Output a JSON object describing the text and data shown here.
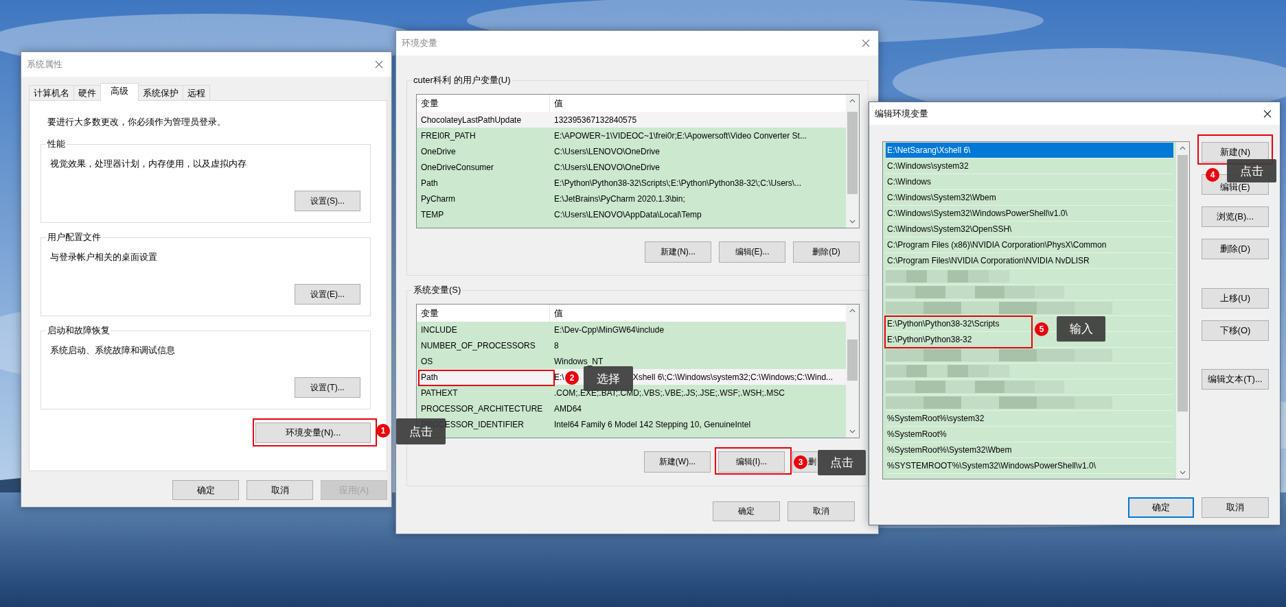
{
  "system_properties": {
    "title": "系统属性",
    "tabs": [
      {
        "label": "计算机名",
        "selected": false
      },
      {
        "label": "硬件",
        "selected": false
      },
      {
        "label": "高级",
        "selected": true
      },
      {
        "label": "系统保护",
        "selected": false
      },
      {
        "label": "远程",
        "selected": false
      }
    ],
    "notice": "要进行大多数更改，你必须作为管理员登录。",
    "groups": [
      {
        "title": "性能",
        "description": "视觉效果，处理器计划，内存使用，以及虚拟内存",
        "button": "设置(S)..."
      },
      {
        "title": "用户配置文件",
        "description": "与登录帐户相关的桌面设置",
        "button": "设置(E)..."
      },
      {
        "title": "启动和故障恢复",
        "description": "系统启动、系统故障和调试信息",
        "button": "设置(T)..."
      }
    ],
    "env_button": "环境变量(N)...",
    "buttons": [
      {
        "label": "确定",
        "disabled": false
      },
      {
        "label": "取消",
        "disabled": false
      },
      {
        "label": "应用(A)",
        "disabled": true
      }
    ]
  },
  "environment_variables": {
    "title": "环境变量",
    "sections": [
      {
        "title": "cuter科利 的用户变量(U)",
        "columns": [
          "变量",
          "值"
        ],
        "rows": [
          {
            "name": "ChocolateyLastPathUpdate",
            "value": "132395367132840575",
            "selected": true
          },
          {
            "name": "FREI0R_PATH",
            "value": "E:\\APOWER~1\\VIDEOC~1\\frei0r;E:\\Apowersoft\\Video Converter St...",
            "selected": false
          },
          {
            "name": "OneDrive",
            "value": "C:\\Users\\LENOVO\\OneDrive",
            "selected": false
          },
          {
            "name": "OneDriveConsumer",
            "value": "C:\\Users\\LENOVO\\OneDrive",
            "selected": false
          },
          {
            "name": "Path",
            "value": "E:\\Python\\Python38-32\\Scripts\\;E:\\Python\\Python38-32\\;C:\\Users\\...",
            "selected": false
          },
          {
            "name": "PyCharm",
            "value": "E:\\JetBrains\\PyCharm 2020.1.3\\bin;",
            "selected": false
          },
          {
            "name": "TEMP",
            "value": "C:\\Users\\LENOVO\\AppData\\Local\\Temp",
            "selected": false
          }
        ],
        "buttons": [
          "新建(N)...",
          "编辑(E)...",
          "删除(D)"
        ]
      },
      {
        "title": "系统变量(S)",
        "columns": [
          "变量",
          "值"
        ],
        "rows": [
          {
            "name": "INCLUDE",
            "value": "E:\\Dev-Cpp\\MinGW64\\include",
            "selected": false
          },
          {
            "name": "NUMBER_OF_PROCESSORS",
            "value": "8",
            "selected": false
          },
          {
            "name": "OS",
            "value": "Windows_NT",
            "selected": false
          },
          {
            "name": "Path",
            "value": [
              "E:\\",
              "Xshell 6\\;C:\\Windows\\system32;C:\\Windows;C:\\Wind..."
            ],
            "selected": true
          },
          {
            "name": "PATHEXT",
            "value": ".COM;.EXE;.BAT;.CMD;.VBS;.VBE;.JS;.JSE;.WSF;.WSH;.MSC",
            "selected": false
          },
          {
            "name": "PROCESSOR_ARCHITECTURE",
            "value": "AMD64",
            "selected": false
          },
          {
            "name": "PROCESSOR_IDENTIFIER",
            "value": "Intel64 Family 6 Model 142 Stepping 10, GenuineIntel",
            "selected": false
          }
        ],
        "buttons": [
          "新建(W)...",
          "编辑(I)...",
          "删"
        ]
      }
    ],
    "buttons": [
      "确定",
      "取消"
    ]
  },
  "edit_variable": {
    "title": "编辑环境变量",
    "entries": [
      {
        "kind": "path",
        "text": "E:\\NetSarang\\Xshell 6\\",
        "selected": true
      },
      {
        "kind": "path",
        "text": "C:\\Windows\\system32",
        "selected": false
      },
      {
        "kind": "path",
        "text": "C:\\Windows",
        "selected": false
      },
      {
        "kind": "path",
        "text": "C:\\Windows\\System32\\Wbem",
        "selected": false
      },
      {
        "kind": "path",
        "text": "C:\\Windows\\System32\\WindowsPowerShell\\v1.0\\",
        "selected": false
      },
      {
        "kind": "path",
        "text": "C:\\Windows\\System32\\OpenSSH\\",
        "selected": false
      },
      {
        "kind": "path",
        "text": "C:\\Program Files (x86)\\NVIDIA Corporation\\PhysX\\Common",
        "selected": false
      },
      {
        "kind": "path",
        "text": "C:\\Program Files\\NVIDIA Corporation\\NVIDIA NvDLISR",
        "selected": false
      },
      {
        "kind": "blurred"
      },
      {
        "kind": "blurred"
      },
      {
        "kind": "blurred"
      },
      {
        "kind": "path",
        "text": "E:\\Python\\Python38-32\\Scripts",
        "selected": false
      },
      {
        "kind": "path",
        "text": "E:\\Python\\Python38-32",
        "selected": false
      },
      {
        "kind": "blurred"
      },
      {
        "kind": "blurred"
      },
      {
        "kind": "blurred"
      },
      {
        "kind": "blurred"
      },
      {
        "kind": "path",
        "text": "%SystemRoot%\\system32",
        "selected": false
      },
      {
        "kind": "path",
        "text": "%SystemRoot%",
        "selected": false
      },
      {
        "kind": "path",
        "text": "%SystemRoot%\\System32\\Wbem",
        "selected": false
      },
      {
        "kind": "path",
        "text": "%SYSTEMROOT%\\System32\\WindowsPowerShell\\v1.0\\",
        "selected": false
      }
    ],
    "side_buttons": [
      "新建(N)",
      "编辑(E)",
      "浏览(B)...",
      "删除(D)",
      "上移(U)",
      "下移(O)",
      "编辑文本(T)..."
    ],
    "buttons": [
      {
        "label": "确定",
        "default": true
      },
      {
        "label": "取消",
        "default": false
      }
    ]
  },
  "annotations": [
    {
      "number": "1",
      "text": "点击"
    },
    {
      "number": "2",
      "text": "选择"
    },
    {
      "number": "3",
      "text": "点击"
    },
    {
      "number": "4",
      "text": "点击"
    },
    {
      "number": "5",
      "text": "输入"
    }
  ]
}
